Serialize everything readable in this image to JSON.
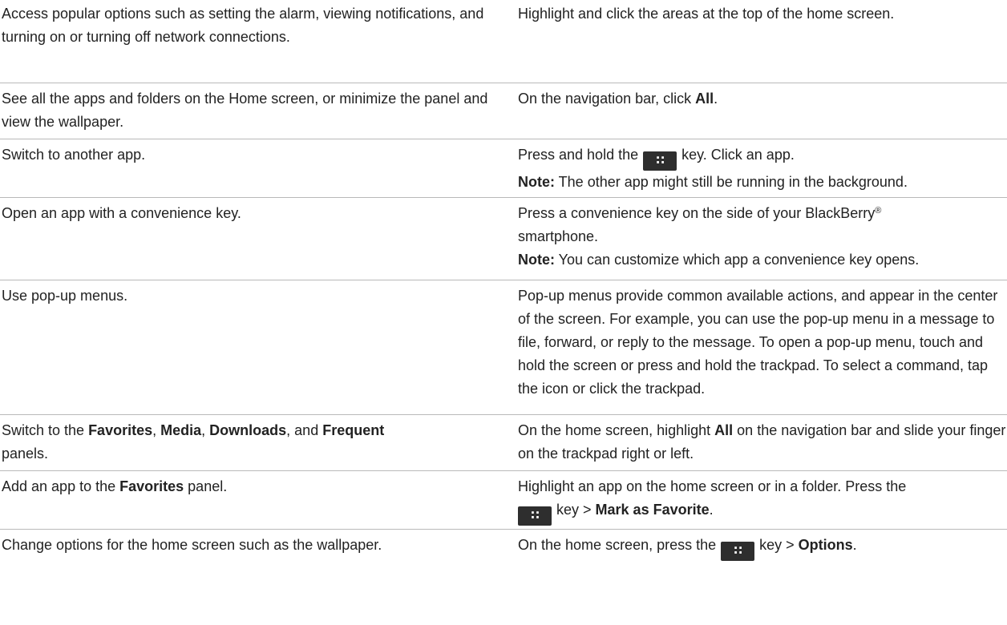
{
  "rows": [
    {
      "task": "Access popular options such as setting the alarm, viewing notifications, and turning on or turning off network connections.",
      "action": "Highlight and click the areas at the top of the home screen."
    },
    {
      "task": "See all the apps and folders on the Home screen, or minimize the panel and view the wallpaper.",
      "action_pre": "On the navigation bar, click ",
      "action_bold": "All",
      "action_post": "."
    },
    {
      "task": "Switch to another app.",
      "action_pre": "Press and hold the",
      "action_post": "key. Click an app.",
      "note_label": "Note:",
      "note_text": " The other app might still be running in the background."
    },
    {
      "task": "Open an app with a convenience key.",
      "action_pre": "Press a convenience key on the side of your BlackBerry",
      "action_reg": "®",
      "action_post": "smartphone.",
      "note_label": "Note:",
      "note_text": " You can customize which app a convenience key opens."
    },
    {
      "task": "Use pop-up menus.",
      "action": "Pop-up menus provide common available actions, and appear in the center of the screen. For example, you can use the pop-up menu in a message to file, forward, or reply to the message. To open a pop-up menu, touch and hold the screen or press and hold the trackpad. To select a command, tap the icon or click the trackpad."
    },
    {
      "task_pre": "Switch to the ",
      "task_b1": "Favorites",
      "task_s1": ", ",
      "task_b2": "Media",
      "task_s2": ", ",
      "task_b3": "Downloads",
      "task_s3": ", and ",
      "task_b4": "Frequent",
      "task_post": "panels.",
      "action_pre": "On the home screen, highlight ",
      "action_bold": "All",
      "action_post": " on the navigation bar and slide your finger on the trackpad right or left."
    },
    {
      "task_pre": "Add an app to the ",
      "task_bold": "Favorites",
      "task_post": " panel.",
      "action_pre": "Highlight an app on the home screen or in a folder. Press the",
      "action_mid": "key > ",
      "action_bold": "Mark as Favorite",
      "action_post": "."
    },
    {
      "task": "Change options for the home screen such as the wallpaper.",
      "action_pre": "On the home screen, press the",
      "action_mid": "key > ",
      "action_bold": "Options",
      "action_post": "."
    }
  ],
  "icons": {
    "menu_key": "blackberry-menu-key-icon"
  }
}
